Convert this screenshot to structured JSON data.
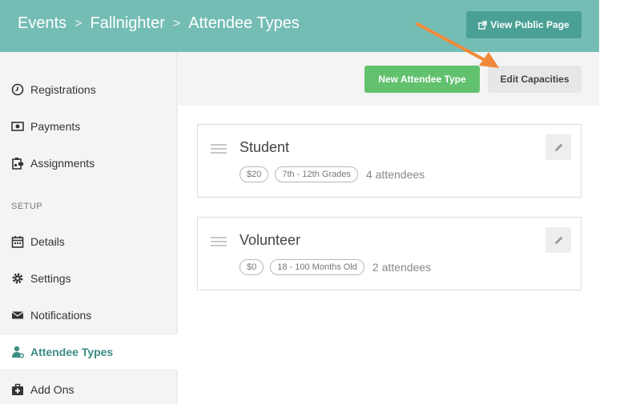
{
  "header": {
    "breadcrumb": [
      "Events",
      "Fallnighter",
      "Attendee Types"
    ],
    "separator": ">",
    "view_public_label": "View Public Page"
  },
  "sidebar": {
    "items": [
      {
        "label": "Registrations",
        "icon": "clock-icon"
      },
      {
        "label": "Payments",
        "icon": "money-icon"
      },
      {
        "label": "Assignments",
        "icon": "assignment-icon"
      }
    ],
    "section_label": "SETUP",
    "setup_items": [
      {
        "label": "Details",
        "icon": "calendar-icon"
      },
      {
        "label": "Settings",
        "icon": "gear-icon"
      },
      {
        "label": "Notifications",
        "icon": "envelope-icon"
      },
      {
        "label": "Attendee Types",
        "icon": "attendee-icon",
        "active": true
      },
      {
        "label": "Add Ons",
        "icon": "medkit-icon"
      }
    ]
  },
  "toolbar": {
    "new_label": "New Attendee Type",
    "edit_label": "Edit Capacities"
  },
  "attendee_types": [
    {
      "name": "Student",
      "price": "$20",
      "range": "7th - 12th Grades",
      "count": "4 attendees"
    },
    {
      "name": "Volunteer",
      "price": "$0",
      "range": "18 - 100 Months Old",
      "count": "2 attendees"
    }
  ],
  "colors": {
    "header": "#74bdb4",
    "primary_dark": "#4aa095",
    "green": "#62c16e",
    "accent_text": "#3c8c82",
    "arrow": "#f0893a"
  }
}
